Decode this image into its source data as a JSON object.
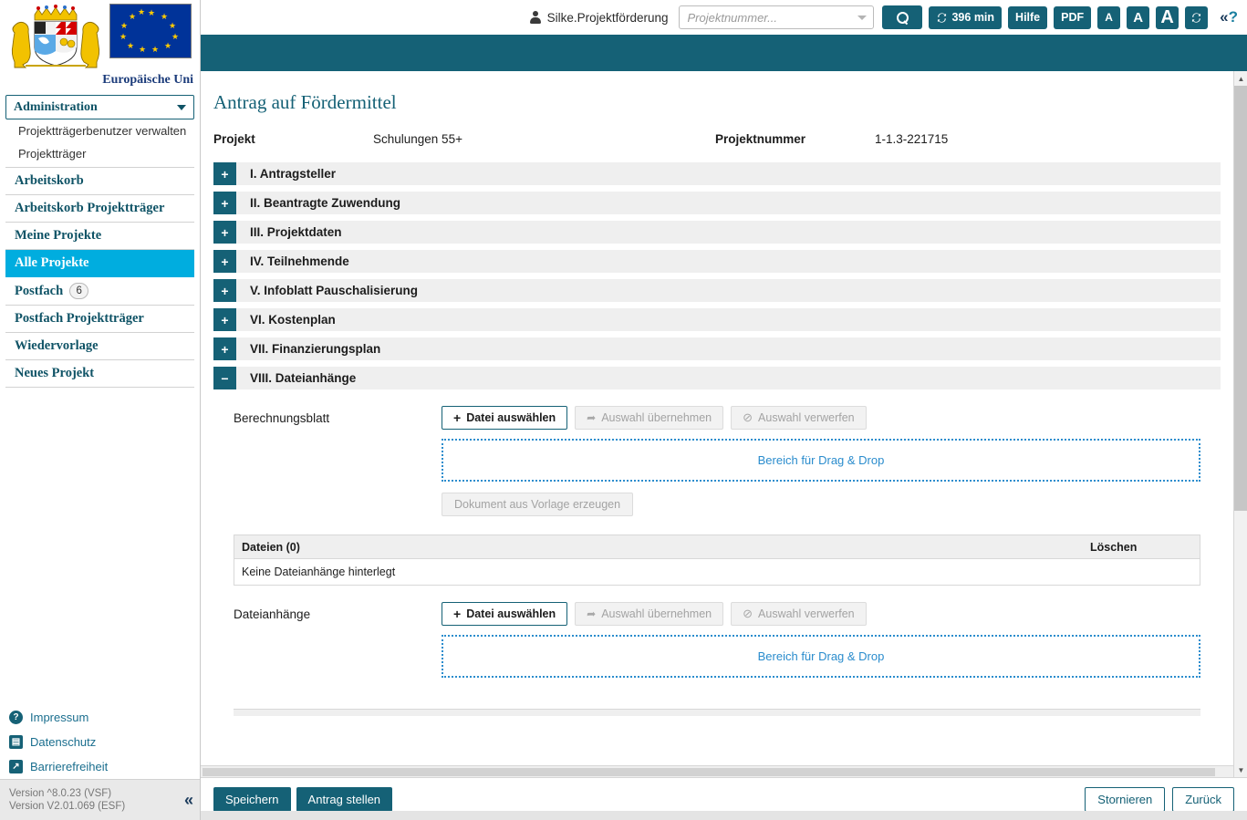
{
  "header": {
    "user_name": "Silke.Projektförderung",
    "user_icon": "user-icon",
    "search_placeholder": "Projektnummer...",
    "search_value": "",
    "search_button_icon": "search-icon",
    "session_timer": "396 min",
    "help_label": "Hilfe",
    "pdf_label": "PDF",
    "font_small": "A",
    "font_medium": "A",
    "font_large": "A",
    "refresh_icon": "sync-icon",
    "help_collapse_icon": "double-chevron-question-icon",
    "accent_teal": "#156176"
  },
  "sidebar": {
    "logo_crest_alt": "bayern-coat-of-arms",
    "logo_eu_alt": "european-union-flag",
    "eu_caption": "Europäische Uni",
    "dropdown": {
      "label": "Administration",
      "options": [
        "Administration"
      ]
    },
    "sub_items": [
      {
        "label": "Projektträgerbenutzer verwalten"
      },
      {
        "label": "Projektträger"
      }
    ],
    "items": [
      {
        "label": "Arbeitskorb",
        "active": false
      },
      {
        "label": "Arbeitskorb Projektträger",
        "active": false
      },
      {
        "label": "Meine Projekte",
        "active": false
      },
      {
        "label": "Alle Projekte",
        "active": true
      },
      {
        "label": "Postfach",
        "badge": "6",
        "active": false
      },
      {
        "label": "Postfach Projektträger",
        "active": false
      },
      {
        "label": "Wiedervorlage",
        "active": false
      },
      {
        "label": "Neues Projekt",
        "active": false
      }
    ],
    "active_color": "#00ADDF",
    "footer_links": [
      {
        "label": "Impressum",
        "icon": "question-circle-icon"
      },
      {
        "label": "Datenschutz",
        "icon": "privacy-document-icon"
      },
      {
        "label": "Barrierefreiheit",
        "icon": "accessibility-arrow-icon"
      }
    ],
    "version_line1": "Version ^8.0.23 (VSF)",
    "version_line2": "Version V2.01.069 (ESF)",
    "collapse_icon": "double-chevron-left-icon"
  },
  "main": {
    "page_title": "Antrag auf Fördermittel",
    "project_label": "Projekt",
    "project_value": "Schulungen 55+",
    "project_number_label": "Projektnummer",
    "project_number_value": "1-1.3-221715",
    "sections": [
      {
        "toggle": "+",
        "title": "I. Antragsteller",
        "expanded": false
      },
      {
        "toggle": "+",
        "title": "II. Beantragte Zuwendung",
        "expanded": false
      },
      {
        "toggle": "+",
        "title": "III. Projektdaten",
        "expanded": false
      },
      {
        "toggle": "+",
        "title": "IV. Teilnehmende",
        "expanded": false
      },
      {
        "toggle": "+",
        "title": "V. Infoblatt Pauschalisierung",
        "expanded": false
      },
      {
        "toggle": "+",
        "title": "VI. Kostenplan",
        "expanded": false
      },
      {
        "toggle": "+",
        "title": "VII. Finanzierungsplan",
        "expanded": false
      },
      {
        "toggle": "−",
        "title": "VIII. Dateianhänge",
        "expanded": true
      }
    ],
    "attachments": {
      "group1": {
        "label": "Berechnungsblatt",
        "select_file_label": "Datei auswählen",
        "apply_selection_label": "Auswahl übernehmen",
        "discard_selection_label": "Auswahl verwerfen",
        "dropzone_label": "Bereich für Drag & Drop",
        "template_button_label": "Dokument aus Vorlage erzeugen",
        "table": {
          "col_files": "Dateien (0)",
          "col_delete": "Löschen",
          "empty_message": "Keine Dateianhänge hinterlegt"
        }
      },
      "group2": {
        "label": "Dateianhänge",
        "select_file_label": "Datei auswählen",
        "apply_selection_label": "Auswahl übernehmen",
        "discard_selection_label": "Auswahl verwerfen",
        "dropzone_label": "Bereich für Drag & Drop"
      }
    }
  },
  "footer": {
    "save_label": "Speichern",
    "submit_label": "Antrag stellen",
    "cancel_label": "Stornieren",
    "back_label": "Zurück"
  }
}
